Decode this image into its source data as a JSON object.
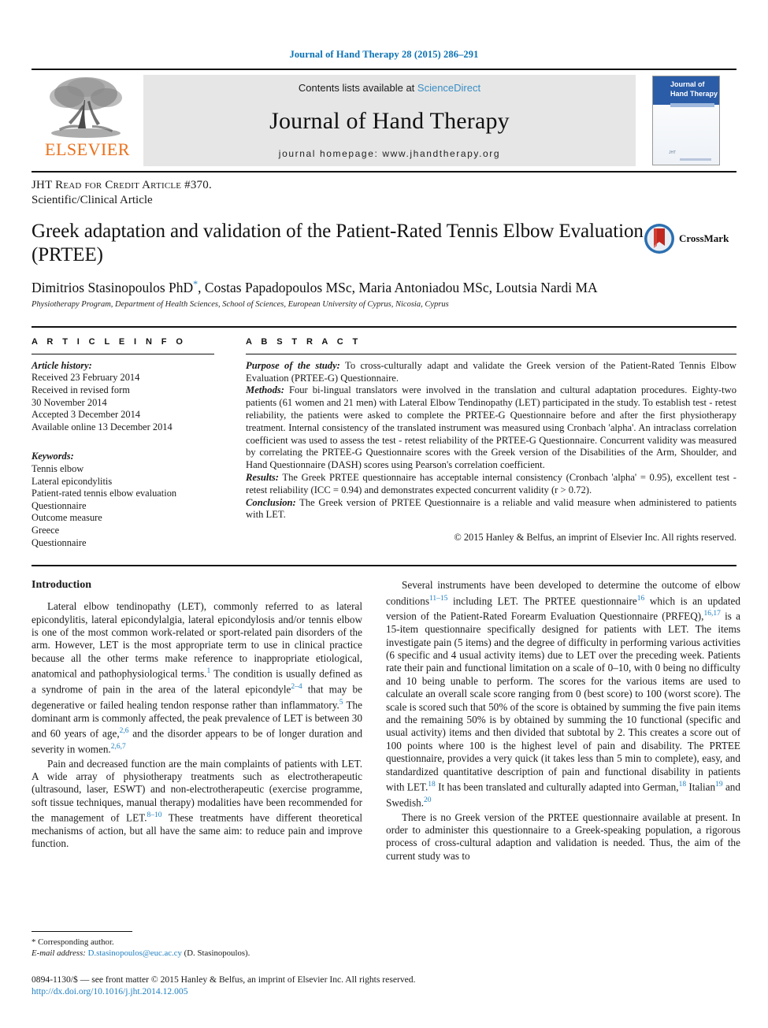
{
  "running_head": "Journal of Hand Therapy 28 (2015) 286–291",
  "masthead": {
    "publisher_name": "ELSEVIER",
    "contents_prefix": "Contents lists available at ",
    "contents_link": "ScienceDirect",
    "journal_name": "Journal of Hand Therapy",
    "homepage": "journal homepage: www.jhandtherapy.org",
    "cover": {
      "title_line1": "Journal of",
      "title_line2": "Hand Therapy",
      "foot_mark": "JHT"
    }
  },
  "article": {
    "credit_line": "JHT Read for Credit Article #370.",
    "type_line": "Scientific/Clinical Article",
    "title": "Greek adaptation and validation of the Patient-Rated Tennis Elbow Evaluation (PRTEE)",
    "crossmark_label": "CrossMark",
    "authors": "Dimitrios Stasinopoulos PhD",
    "authors_rest": ", Costas Papadopoulos MSc, Maria Antoniadou MSc, Loutsia Nardi MA",
    "affiliation": "Physiotherapy Program, Department of Health Sciences, School of Sciences, European University of Cyprus, Nicosia, Cyprus"
  },
  "info": {
    "heading": "A R T I C L E   I N F O",
    "history_label": "Article history:",
    "history": [
      "Received 23 February 2014",
      "Received in revised form",
      "30 November 2014",
      "Accepted 3 December 2014",
      "Available online 13 December 2014"
    ],
    "keywords_label": "Keywords:",
    "keywords": [
      "Tennis elbow",
      "Lateral epicondylitis",
      "Patient-rated tennis elbow evaluation",
      "Questionnaire",
      "Outcome measure",
      "Greece",
      "Questionnaire"
    ]
  },
  "abstract": {
    "heading": "A B S T R A C T",
    "purpose_label": "Purpose of the study:",
    "purpose_text": " To cross-culturally adapt and validate the Greek version of the Patient-Rated Tennis Elbow Evaluation (PRTEE-G) Questionnaire.",
    "methods_label": "Methods:",
    "methods_text": " Four bi-lingual translators were involved in the translation and cultural adaptation procedures. Eighty-two patients (61 women and 21 men) with Lateral Elbow Tendinopathy (LET) participated in the study. To establish test - retest reliability, the patients were asked to complete the PRTEE-G Questionnaire before and after the first physiotherapy treatment. Internal consistency of the translated instrument was measured using Cronbach 'alpha'. An intraclass correlation coefficient was used to assess the test - retest reliability of the PRTEE-G Questionnaire. Concurrent validity was measured by correlating the PRTEE-G Questionnaire scores with the Greek version of the Disabilities of the Arm, Shoulder, and Hand Questionnaire (DASH) scores using Pearson's correlation coefficient.",
    "results_label": "Results:",
    "results_text": " The Greek PRTEE questionnaire has acceptable internal consistency (Cronbach 'alpha' = 0.95), excellent test - retest reliability (ICC = 0.94) and demonstrates expected concurrent validity (r > 0.72).",
    "conclusion_label": "Conclusion:",
    "conclusion_text": " The Greek version of PRTEE Questionnaire is a reliable and valid measure when administered to patients with LET.",
    "copyright": "© 2015 Hanley & Belfus, an imprint of Elsevier Inc. All rights reserved."
  },
  "body": {
    "intro_heading": "Introduction",
    "left_p1_a": "Lateral elbow tendinopathy (LET), commonly referred to as lateral epicondylitis, lateral epicondylalgia, lateral epicondylosis and/or tennis elbow is one of the most common work-related or sport-related pain disorders of the arm. However, LET is the most appropriate term to use in clinical practice because all the other terms make reference to inappropriate etiological, anatomical and pathophysiological terms.",
    "left_p1_r1": "1",
    "left_p1_b": " The condition is usually defined as a syndrome of pain in the area of the lateral epicondyle",
    "left_p1_r2": "2–4",
    "left_p1_c": " that may be degenerative or failed healing tendon response rather than inflammatory.",
    "left_p1_r3": "5",
    "left_p1_d": " The dominant arm is commonly affected, the peak prevalence of LET is between 30 and 60 years of age,",
    "left_p1_r4": "2,6",
    "left_p1_e": " and the disorder appears to be of longer duration and severity in women.",
    "left_p1_r5": "2,6,7",
    "left_p2_a": "Pain and decreased function are the main complaints of patients with LET. A wide array of physiotherapy treatments such as electrotherapeutic (ultrasound, laser, ESWT) and non-electrotherapeutic (exercise programme, soft tissue techniques, manual therapy) modalities have been recommended for the management of LET.",
    "left_p2_r1": "8–10",
    "left_p2_b": " These treatments have different theoretical mechanisms of action, but all have the same aim: to reduce pain and improve function.",
    "right_p1_a": "Several instruments have been developed to determine the outcome of elbow conditions",
    "right_p1_r1": "11–15",
    "right_p1_b": " including LET. The PRTEE questionnaire",
    "right_p1_r2": "16",
    "right_p1_c": " which is an updated version of the Patient-Rated Forearm Evaluation Questionnaire (PRFEQ),",
    "right_p1_r3": "16,17",
    "right_p1_d": " is a 15-item questionnaire specifically designed for patients with LET. The items investigate pain (5 items) and the degree of difficulty in performing various activities (6 specific and 4 usual activity items) due to LET over the preceding week. Patients rate their pain and functional limitation on a scale of 0–10, with 0 being no difficulty and 10 being unable to perform. The scores for the various items are used to calculate an overall scale score ranging from 0 (best score) to 100 (worst score). The scale is scored such that 50% of the score is obtained by summing the five pain items and the remaining 50% is by obtained by summing the 10 functional (specific and usual activity) items and then divided that subtotal by 2. This creates a score out of 100 points where 100 is the highest level of pain and disability. The PRTEE questionnaire, provides a very quick (it takes less than 5 min to complete), easy, and standardized quantitative description of pain and functional disability in patients with LET.",
    "right_p1_r4": "18",
    "right_p1_e": " It has been translated and culturally adapted into German,",
    "right_p1_r5": "18",
    "right_p1_f": " Italian",
    "right_p1_r6": "19",
    "right_p1_g": " and Swedish.",
    "right_p1_r7": "20",
    "right_p2": "There is no Greek version of the PRTEE questionnaire available at present. In order to administer this questionnaire to a Greek-speaking population, a rigorous process of cross-cultural adaption and validation is needed. Thus, the aim of the current study was to"
  },
  "footnotes": {
    "corresponding": "* Corresponding author.",
    "email_label": "E-mail address: ",
    "email": "D.stasinopoulos@euc.ac.cy",
    "email_suffix": " (D. Stasinopoulos)."
  },
  "footer": {
    "issn_line": "0894-1130/$ — see front matter © 2015 Hanley & Belfus, an imprint of Elsevier Inc. All rights reserved.",
    "doi": "http://dx.doi.org/10.1016/j.jht.2014.12.005"
  },
  "colors": {
    "link": "#1f7fc0",
    "elsevier_orange": "#E9711C",
    "cover_blue": "#2a5ca8"
  }
}
